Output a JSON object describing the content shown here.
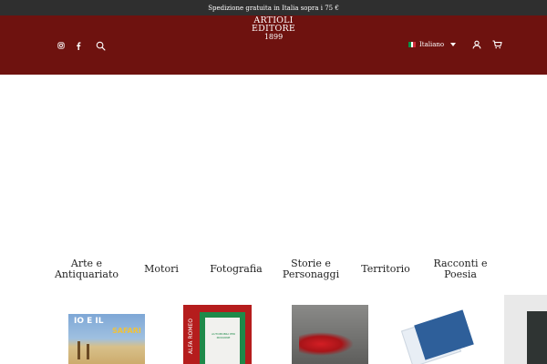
{
  "announcement": "Spedizione gratuita in Italia sopra i 75 €",
  "logo": {
    "line1": "ARTIOLI",
    "line2": "EDITORE",
    "line3": "1899"
  },
  "header": {
    "social_icons": [
      "instagram-icon",
      "facebook-icon"
    ],
    "search_icon": "search-icon",
    "language": {
      "label": "Italiano",
      "flag_colors": [
        "#009246",
        "#ffffff",
        "#ce2b37"
      ]
    },
    "account_icon": "user-icon",
    "cart_icon": "cart-icon"
  },
  "colors": {
    "topbar": "#2f2f2f",
    "header": "#6e120f",
    "text": "#222222"
  },
  "categories": [
    {
      "label": "Arte e Antiquariato"
    },
    {
      "label": "Motori"
    },
    {
      "label": "Fotografia"
    },
    {
      "label": "Storie e Personaggi"
    },
    {
      "label": "Territorio"
    },
    {
      "label": "Racconti e Poesia"
    }
  ],
  "books": {
    "b1": {
      "title": "IO E IL",
      "subtitle": "SAFARI"
    },
    "b2": {
      "spine": "ALFA ROMEO",
      "caption": "AUTOMOBILI PER PASSIONE"
    }
  }
}
